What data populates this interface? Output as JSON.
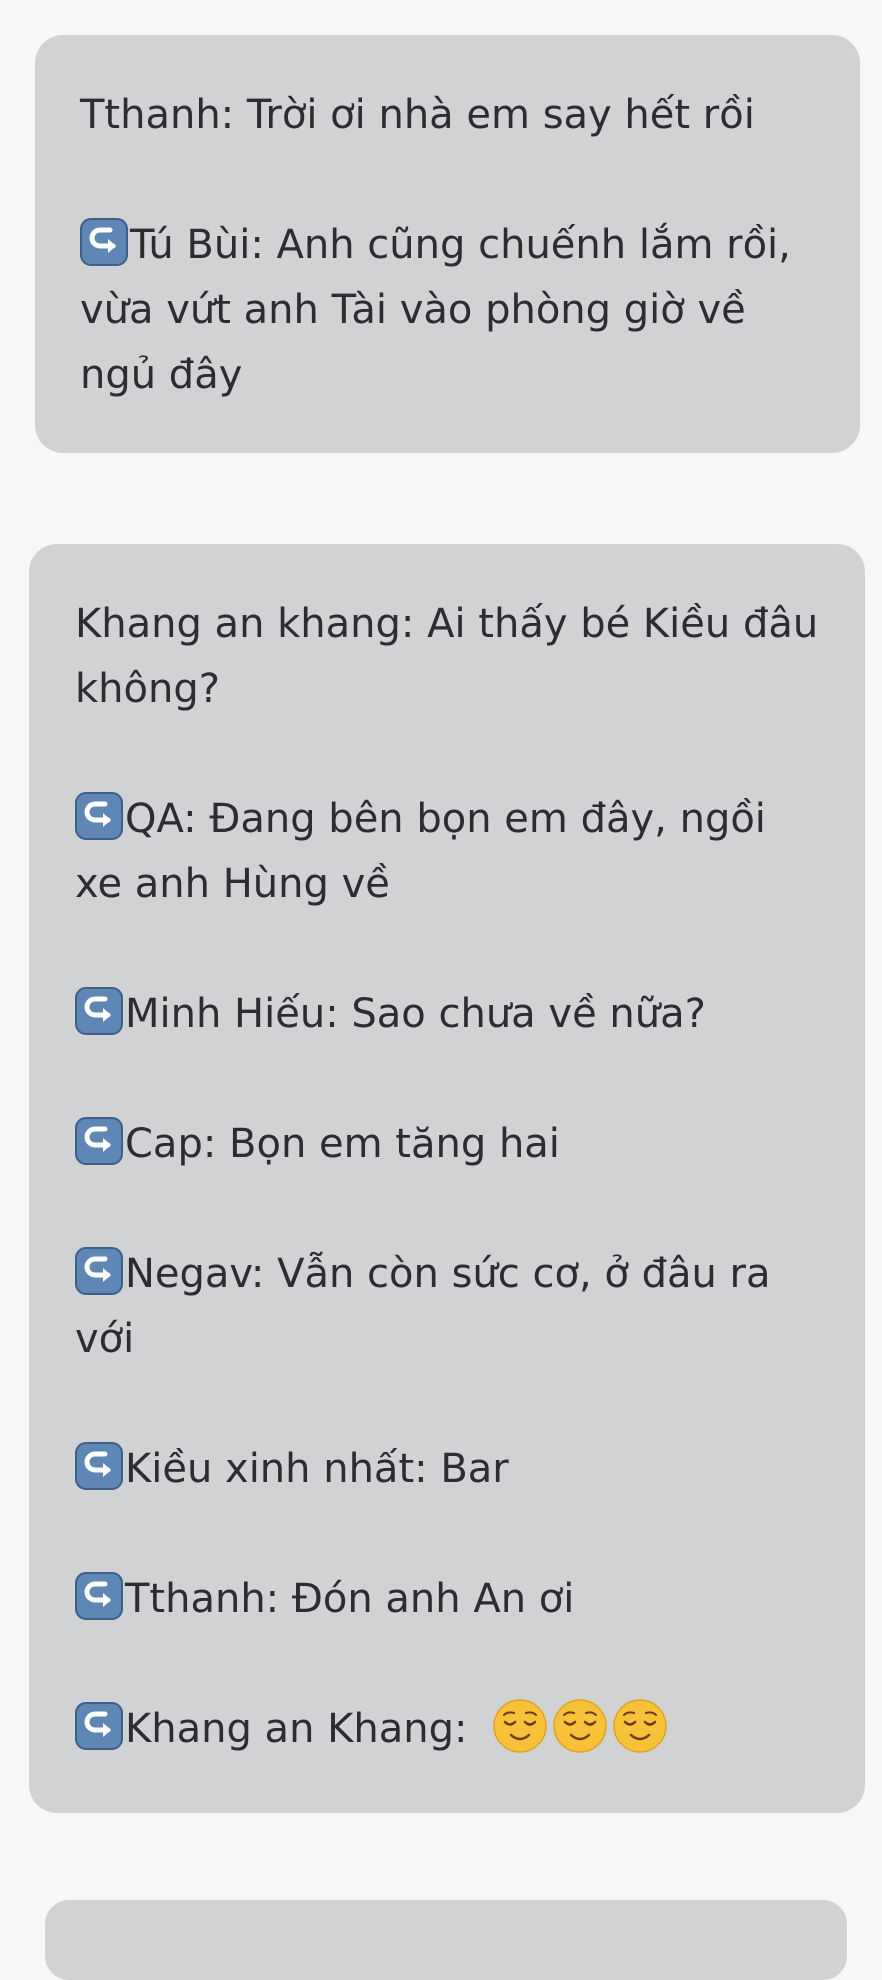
{
  "post1": {
    "main": "Tthanh: Trời ơi nhà em say hết rồi",
    "replies": [
      "Tú Bùi: Anh cũng chuếnh lắm rồi, vừa vứt anh Tài vào phòng giờ về ngủ đây"
    ]
  },
  "post2": {
    "main": "Khang an khang: Ai thấy bé Kiều đâu không?",
    "replies": [
      "QA: Đang bên bọn em đây, ngồi xe anh Hùng về",
      "Minh Hiếu: Sao chưa về nữa?",
      "Cap: Bọn em tăng hai",
      "Negav: Vẫn còn sức cơ, ở đâu ra với",
      "Kiều xinh nhất: Bar",
      "Tthanh: Đón anh An ơi",
      "Khang an Khang:"
    ],
    "last_reply_emojis": [
      "relieved-face",
      "relieved-face",
      "relieved-face"
    ]
  },
  "icons": {
    "reply": "right-arrow-curving-left-icon",
    "emoji": "relieved-face"
  },
  "colors": {
    "card": "#d1d2d4",
    "background": "#f6f7f9",
    "reply_icon_fill": "#5e87b5",
    "emoji_fill": "#f7c13a"
  }
}
